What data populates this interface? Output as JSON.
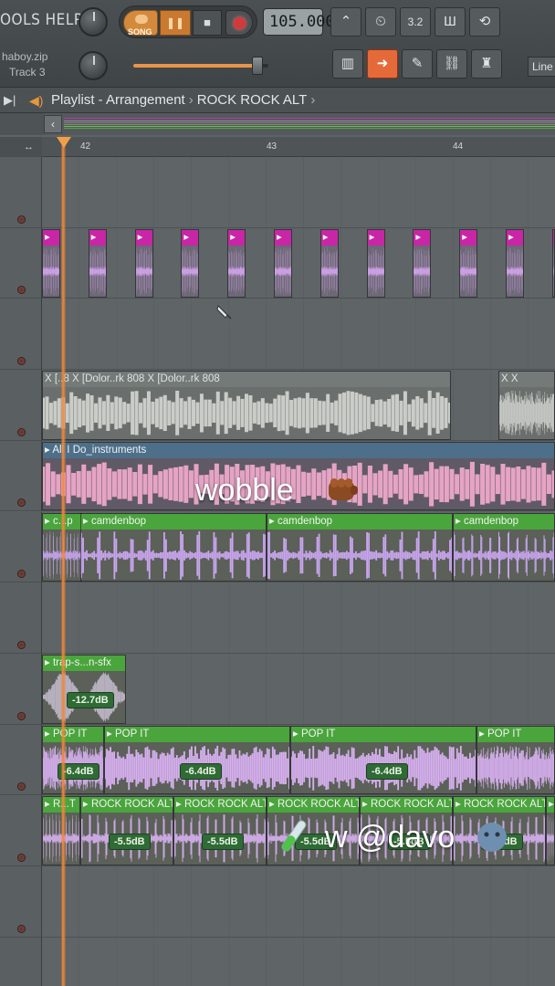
{
  "toolbar": {
    "menu_label": "OOLS HELP",
    "song_label": "SONG",
    "tempo": "105.000",
    "hint_file": "haboy.zip",
    "hint_track": "Track 3",
    "line_mode": "Line",
    "tools": [
      "metronome-icon",
      "wait-icon",
      "count-icon",
      "step-icon",
      "loop-icon",
      "piano-icon",
      "arrow-icon",
      "paint-icon",
      "link-icon",
      "stamp-icon"
    ]
  },
  "playlist": {
    "title": "Playlist - Arrangement",
    "pattern": "ROCK ROCK ALT",
    "separator": "›"
  },
  "ruler": {
    "bars": [
      "42",
      "43",
      "44"
    ]
  },
  "clips": {
    "gray_labels": [
      "[Dolor..rk 808",
      "[Dolor..rk 808"
    ],
    "gray_x": "X",
    "gray_small": "[..8",
    "blue_label": "All I Do_instruments",
    "green_labels": [
      "c...p",
      "camdenbop",
      "camdenbop",
      "camdenbop"
    ],
    "sfx_label": "trap-s...n-sfx",
    "sfx_vol": "-12.7dB",
    "pop_label": "POP IT",
    "pop_vol": "-6.4dB",
    "rock_short": "R...T",
    "rock_label": "ROCK ROCK ALT",
    "rock_vol": "-5.5dB"
  },
  "overlay": {
    "caption1": "wobble",
    "caption2": "w @davo"
  },
  "colors": {
    "pink": "#c826a6",
    "green": "#4aa53c",
    "orange": "#f08a3c"
  }
}
